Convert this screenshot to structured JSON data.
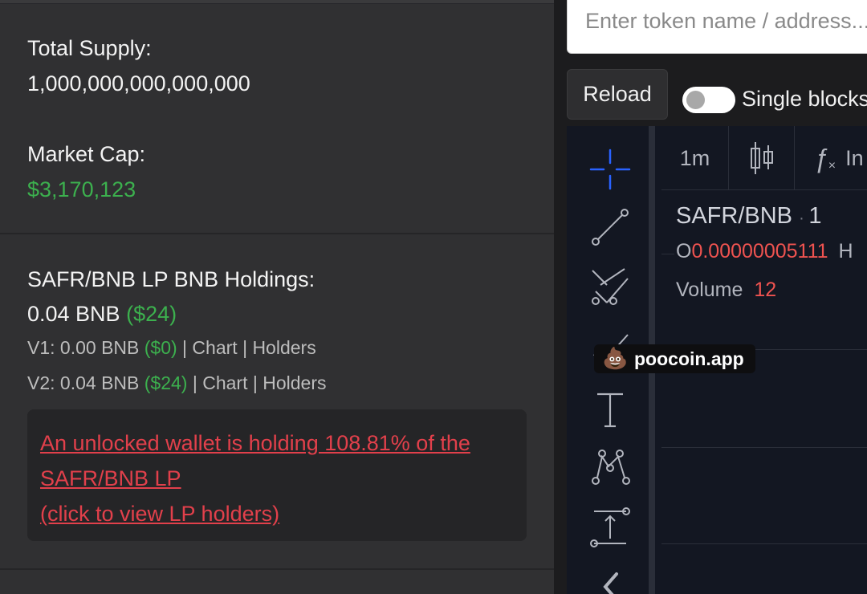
{
  "token_info": {
    "total_supply_label": "Total Supply:",
    "total_supply_value": "1,000,000,000,000,000",
    "market_cap_label": "Market Cap:",
    "market_cap_value": "$3,170,123"
  },
  "lp": {
    "holdings_label": "SAFR/BNB LP BNB Holdings:",
    "total_amount": "0.04 BNB",
    "total_usd": "($24)",
    "v1": {
      "prefix": "V1: 0.00 BNB",
      "usd": "($0)",
      "chart": "Chart",
      "holders": "Holders"
    },
    "v2": {
      "prefix": "V2: 0.04 BNB",
      "usd": "($24)",
      "chart": "Chart",
      "holders": "Holders"
    },
    "separator": "|"
  },
  "warning": {
    "line1": "An unlocked wallet is holding 108.81% of the",
    "line2": "SAFR/BNB LP",
    "line3": "(click to view LP holders)"
  },
  "controls": {
    "search_placeholder": "Enter token name / address...",
    "reload_label": "Reload",
    "single_blocks_label": "Single blocks"
  },
  "chart_widget": {
    "interval": "1m",
    "indicators_abbr": "In",
    "pair": "SAFR/BNB",
    "pair_interval": "1",
    "ohlc_open_label": "O",
    "ohlc_open_value": "0.00000005111",
    "ohlc_high_label": "H",
    "volume_label": "Volume",
    "volume_value": "12",
    "watermark": "poocoin.app"
  },
  "colors": {
    "green": "#3cb04e",
    "red": "#e2404b",
    "panel": "#303032",
    "chart_bg": "#131722"
  }
}
